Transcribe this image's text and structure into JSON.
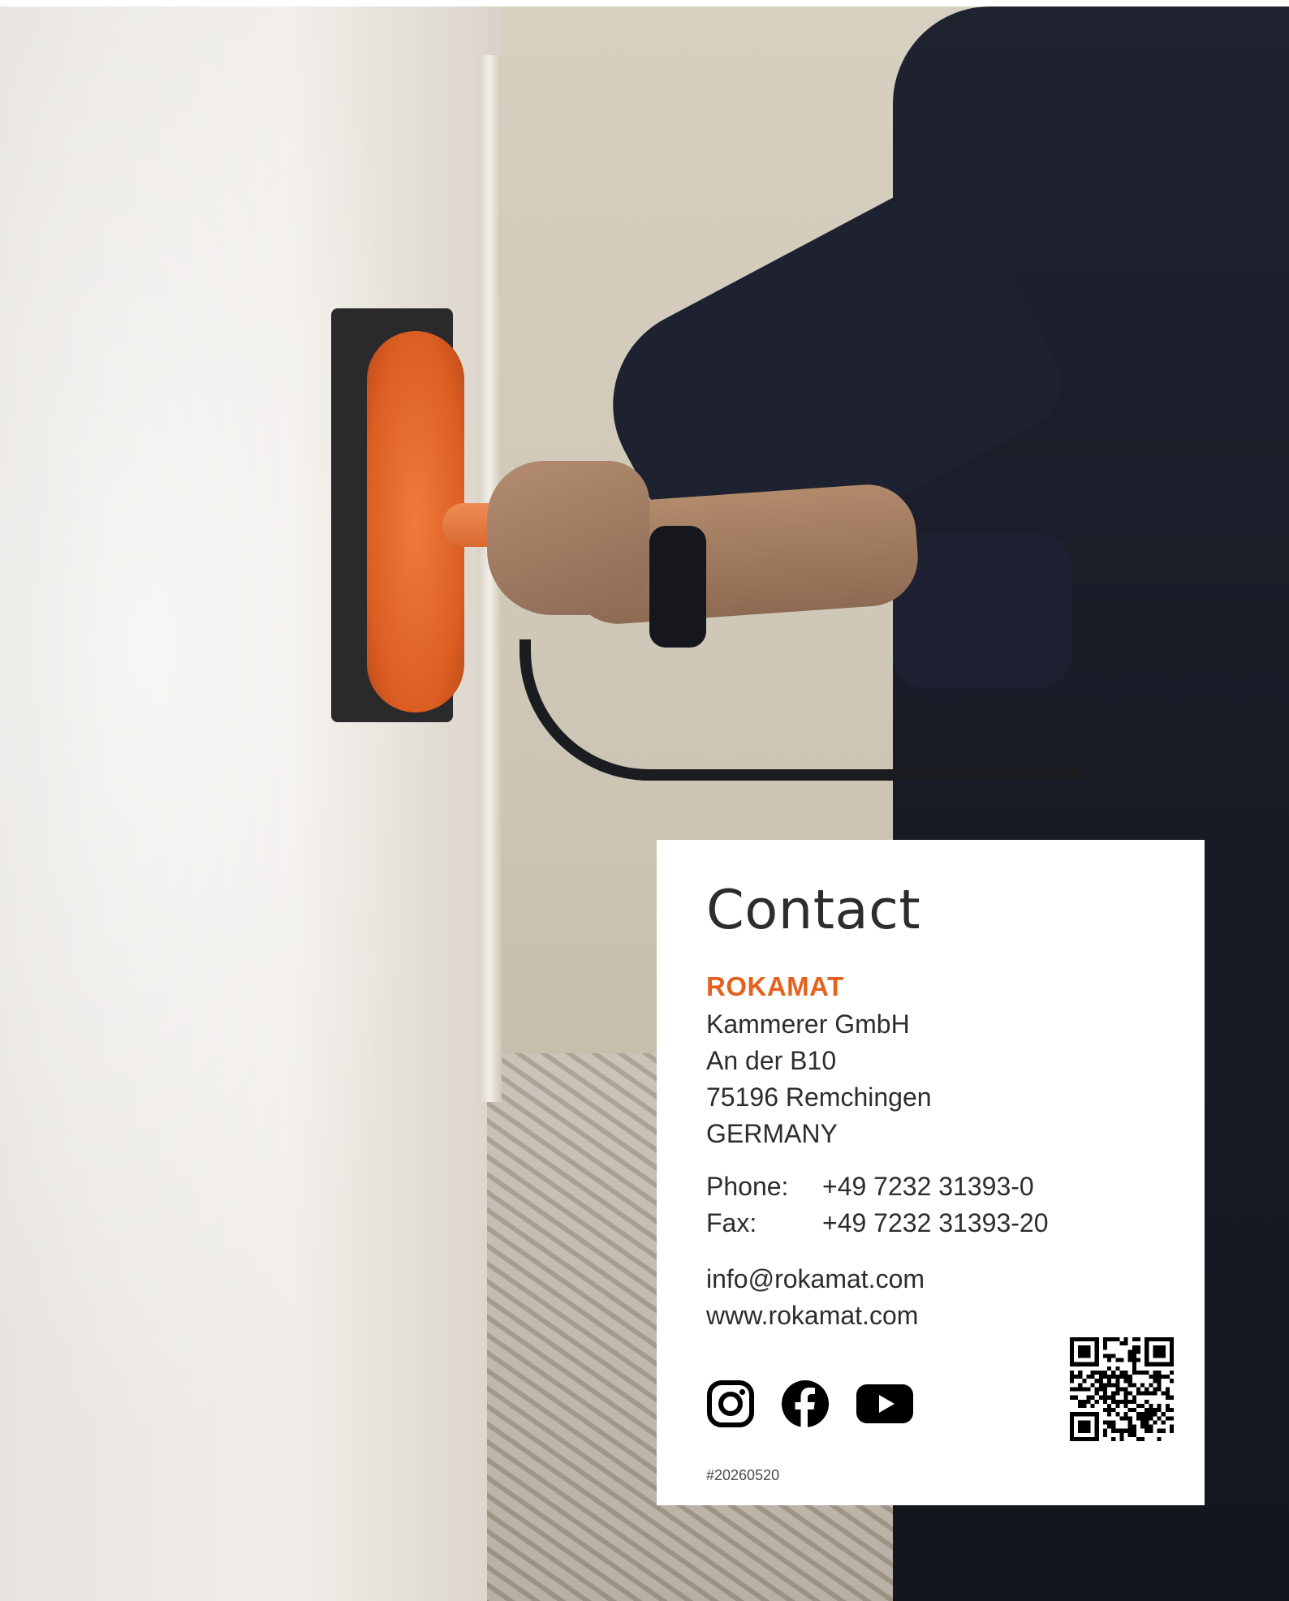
{
  "contact": {
    "title": "Contact",
    "brand": "ROKAMAT",
    "address": [
      "Kammerer GmbH",
      "An der B10",
      "75196 Remchingen",
      "GERMANY"
    ],
    "phone_label": "Phone:",
    "phone_value": "+49 7232 31393-0",
    "fax_label": "Fax:",
    "fax_value": "+49 7232 31393-20",
    "email": "info@rokamat.com",
    "website": "www.rokamat.com",
    "social_icons": [
      "instagram-icon",
      "facebook-icon",
      "youtube-icon"
    ],
    "doc_id": "#20260520"
  },
  "colors": {
    "brand_orange": "#e4611e",
    "text_dark": "#2d2d2f",
    "card_background": "#ffffff"
  }
}
